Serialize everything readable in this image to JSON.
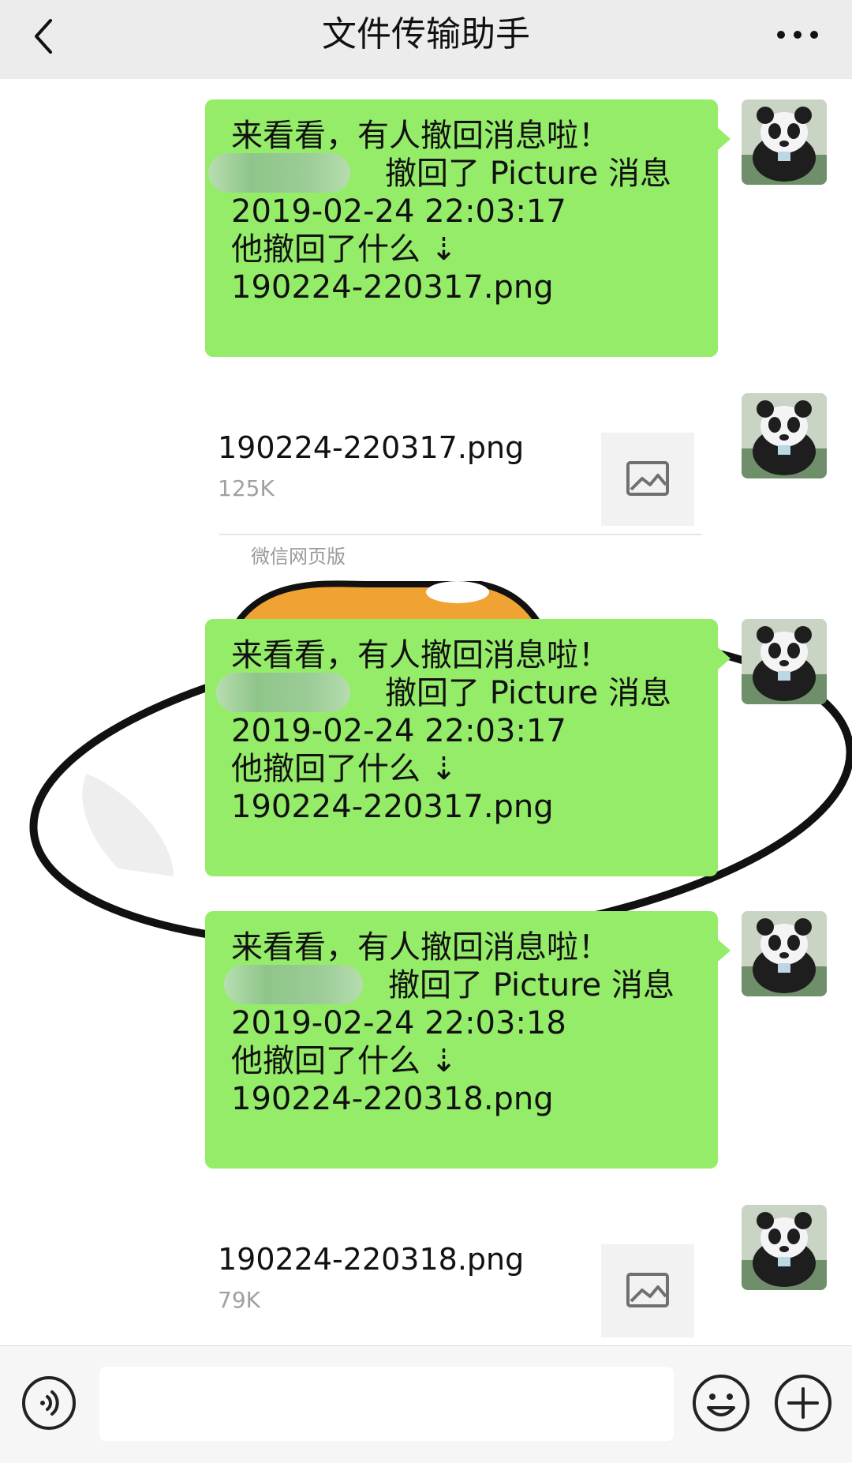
{
  "header": {
    "title": "文件传输助手"
  },
  "messages": [
    {
      "type": "text",
      "lines": [
        "来看看，有人撤回消息啦！",
        "撤回了 Picture 消息",
        "2019-02-24 22:03:17",
        "他撤回了什么 ⇣",
        "190224-220317.png"
      ]
    },
    {
      "type": "file",
      "file_name": "190224-220317.png",
      "file_size": "125K",
      "source": "微信网页版"
    },
    {
      "type": "text",
      "lines": [
        "来看看，有人撤回消息啦！",
        "撤回了 Picture 消息",
        "2019-02-24 22:03:17",
        "他撤回了什么 ⇣",
        "190224-220317.png"
      ]
    },
    {
      "type": "text",
      "lines": [
        "来看看，有人撤回消息啦！",
        "撤回了 Picture 消息",
        "2019-02-24 22:03:18",
        "他撤回了什么 ⇣",
        "190224-220318.png"
      ]
    },
    {
      "type": "file",
      "file_name": "190224-220318.png",
      "file_size": "79K"
    }
  ],
  "icons": {
    "back": "chevron-left-icon",
    "more": "more-dots-icon",
    "voice": "voice-icon",
    "emoji": "emoji-icon",
    "plus": "plus-icon",
    "file_thumb": "image-icon"
  },
  "colors": {
    "bubble_green": "#95ec69",
    "background": "#ededed"
  }
}
